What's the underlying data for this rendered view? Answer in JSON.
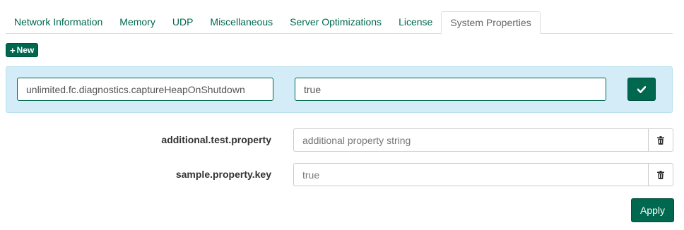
{
  "tabs": [
    {
      "label": "Network Information",
      "active": false
    },
    {
      "label": "Memory",
      "active": false
    },
    {
      "label": "UDP",
      "active": false
    },
    {
      "label": "Miscellaneous",
      "active": false
    },
    {
      "label": "Server Optimizations",
      "active": false
    },
    {
      "label": "License",
      "active": false
    },
    {
      "label": "System Properties",
      "active": true
    }
  ],
  "new_button": {
    "icon": "plus-icon",
    "label": "New"
  },
  "edit_row": {
    "key_value": "unlimited.fc.diagnostics.captureHeapOnShutdown",
    "value_value": "true",
    "confirm_icon": "check-icon"
  },
  "properties": [
    {
      "key": "additional.test.property",
      "value": "",
      "placeholder": "additional property string",
      "delete_icon": "trash-icon"
    },
    {
      "key": "sample.property.key",
      "value": "",
      "placeholder": "true",
      "delete_icon": "trash-icon"
    }
  ],
  "apply_button": {
    "label": "Apply"
  },
  "colors": {
    "accent": "#00684f",
    "edit_panel_bg": "#d3ecf7",
    "tab_text": "#00684f",
    "active_tab_text": "#666666"
  }
}
